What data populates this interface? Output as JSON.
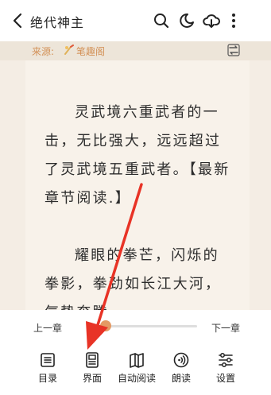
{
  "header": {
    "title": "绝代神主",
    "icons": [
      "back-icon",
      "search-icon",
      "night-mode-icon",
      "download-cloud-icon",
      "more-icon"
    ]
  },
  "source": {
    "label": "来源:",
    "name": "笔趣阁",
    "icons": [
      "source-logo-icon",
      "reader-mode-icon"
    ]
  },
  "content": {
    "paragraphs": [
      "灵武境六重武者的一击，无比强大，远远超过了灵武境五重武者。【最新章节阅读.】",
      "耀眼的拳芒，闪烁的拳影，拳劲如长江大河，气势奔腾,"
    ]
  },
  "progress": {
    "prev_label": "上一章",
    "next_label": "下一章",
    "value": 0.1
  },
  "tabs": [
    {
      "label": "目录",
      "icon": "catalog-icon"
    },
    {
      "label": "界面",
      "icon": "interface-icon"
    },
    {
      "label": "自动阅读",
      "icon": "auto-read-icon"
    },
    {
      "label": "朗读",
      "icon": "read-aloud-icon"
    },
    {
      "label": "设置",
      "icon": "settings-icon"
    }
  ],
  "colors": {
    "accent": "#e49a64",
    "annotation_arrow": "#e83326",
    "reader_background": "#f4ede4",
    "source_text": "#d39157"
  }
}
